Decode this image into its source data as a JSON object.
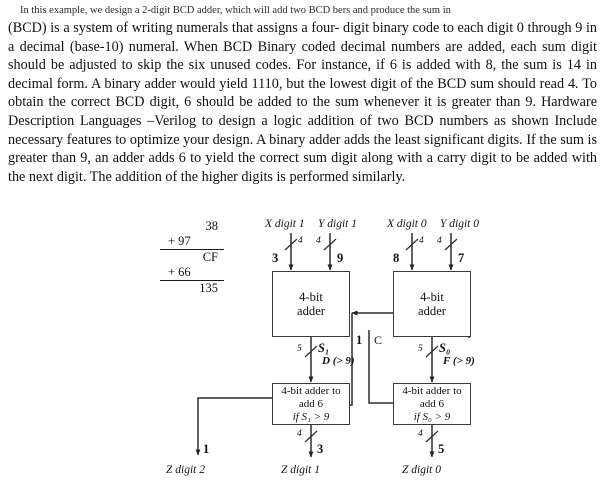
{
  "document": {
    "intro_line": "In this example, we design a 2-digit BCD adder, which will add two BCD  bers and produce the sum in",
    "body": "(BCD) is a system of writing numerals that assigns a four-   digit binary code to each digit 0 through 9 in a decimal (base-10) numeral. When BCD Binary coded decimal numbers are added, each sum digit should be adjusted to skip the six unused codes. For instance, if 6 is added with 8, the sum is 14 in decimal form. A binary adder would yield 1110, but the lowest digit of the BCD sum should read 4. To obtain the correct BCD digit, 6 should be added to the sum whenever it is greater than 9. Hardware Description Languages –Verilog to design a logic  addition of two BCD numbers as shown   Include necessary features to optimize your design. A binary adder adds the least significant digits. If the sum is greater than 9, an adder adds 6 to yield the correct sum digit along with a carry digit to be added with the next digit. The addition of the higher digits is performed similarly."
  },
  "arithmetic": {
    "line1": "38",
    "line2": "+ 97",
    "line3": "CF",
    "line4": "+ 66",
    "line5": "135"
  },
  "diagram": {
    "inputs": [
      {
        "label": "X digit 1",
        "width_tag": "4",
        "value": "3"
      },
      {
        "label": "Y digit 1",
        "width_tag": "4",
        "value": "9"
      },
      {
        "label": "X digit 0",
        "width_tag": "4",
        "value": "8"
      },
      {
        "label": "Y digit 0",
        "width_tag": "4",
        "value": "7"
      }
    ],
    "adders": [
      {
        "line1": "4-bit",
        "line2": "adder"
      },
      {
        "line1": "4-bit",
        "line2": "adder"
      }
    ],
    "correctors": [
      {
        "line1": "4-bit adder to",
        "line2": "add 6",
        "line3": "if S₁ > 9"
      },
      {
        "line1": "4-bit adder to",
        "line2": "add 6",
        "line3": "if S₀ > 9"
      }
    ],
    "sum_buses": [
      {
        "width_tag": "5",
        "name": "S₁",
        "note": "D (> 9)"
      },
      {
        "width_tag": "5",
        "name": "S₀",
        "note": "F (> 9)"
      }
    ],
    "carry": {
      "value": "1",
      "label": "C"
    },
    "outputs": [
      {
        "label": "Z digit 2",
        "width_tag": "",
        "value": "1"
      },
      {
        "label": "Z digit 1",
        "width_tag": "4",
        "value": "3"
      },
      {
        "label": "Z digit 0",
        "width_tag": "4",
        "value": "5"
      }
    ]
  },
  "colors": {
    "ink": "#111111",
    "line": "#3a3a3a",
    "background": "#ffffff"
  }
}
